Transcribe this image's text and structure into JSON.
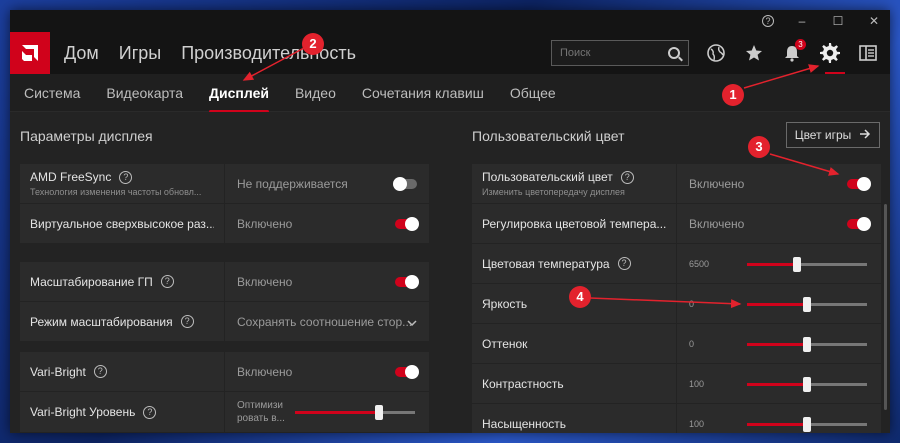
{
  "titlebar": {
    "help": "?",
    "minimize": "–",
    "maximize": "☐",
    "close": "✕"
  },
  "topnav": {
    "items": [
      "Дом",
      "Игры",
      "Производительность"
    ],
    "search_placeholder": "Поиск",
    "notification_count": "3",
    "icons": [
      "globe-icon",
      "star-icon",
      "bell-icon",
      "gear-icon",
      "panel-icon"
    ]
  },
  "subnav": {
    "items": [
      "Система",
      "Видеокарта",
      "Дисплей",
      "Видео",
      "Сочетания клавиш",
      "Общее"
    ],
    "active": "Дисплей"
  },
  "left": {
    "title": "Параметры дисплея",
    "rows": [
      {
        "label": "AMD FreeSync",
        "sub": "Технология изменения частоты обновл...",
        "value": "Не поддерживается",
        "toggle": "off"
      },
      {
        "label": "Виртуальное сверхвысокое раз...",
        "value": "Включено",
        "toggle": "on"
      },
      {
        "label": "Масштабирование ГП",
        "value": "Включено",
        "toggle": "on"
      },
      {
        "label": "Режим масштабирования",
        "value": "Сохранять соотношение стор..."
      },
      {
        "label": "Vari-Bright",
        "value": "Включено",
        "toggle": "on"
      },
      {
        "label": "Vari-Bright Уровень",
        "value_line1": "Оптимизи",
        "value_line2": "ровать в...",
        "slider": 0.7
      }
    ]
  },
  "right": {
    "title": "Пользовательский цвет",
    "game_color_button": "Цвет игры",
    "rows": [
      {
        "label": "Пользовательский цвет",
        "sub": "Изменить цветопередачу дисплея",
        "value": "Включено",
        "toggle": "on"
      },
      {
        "label": "Регулировка цветовой темпера...",
        "value": "Включено",
        "toggle": "on"
      },
      {
        "label": "Цветовая температура",
        "value": "6500",
        "slider": 0.42
      },
      {
        "label": "Яркость",
        "value": "0",
        "slider": 0.5
      },
      {
        "label": "Оттенок",
        "value": "0",
        "slider": 0.5
      },
      {
        "label": "Контрастность",
        "value": "100",
        "slider": 0.5
      },
      {
        "label": "Насыщенность",
        "value": "100",
        "slider": 0.5
      }
    ]
  },
  "annotations": [
    "1",
    "2",
    "3",
    "4"
  ],
  "colors": {
    "accent": "#d0021b",
    "marker": "#e3222d",
    "background": "#1f1f1f"
  }
}
